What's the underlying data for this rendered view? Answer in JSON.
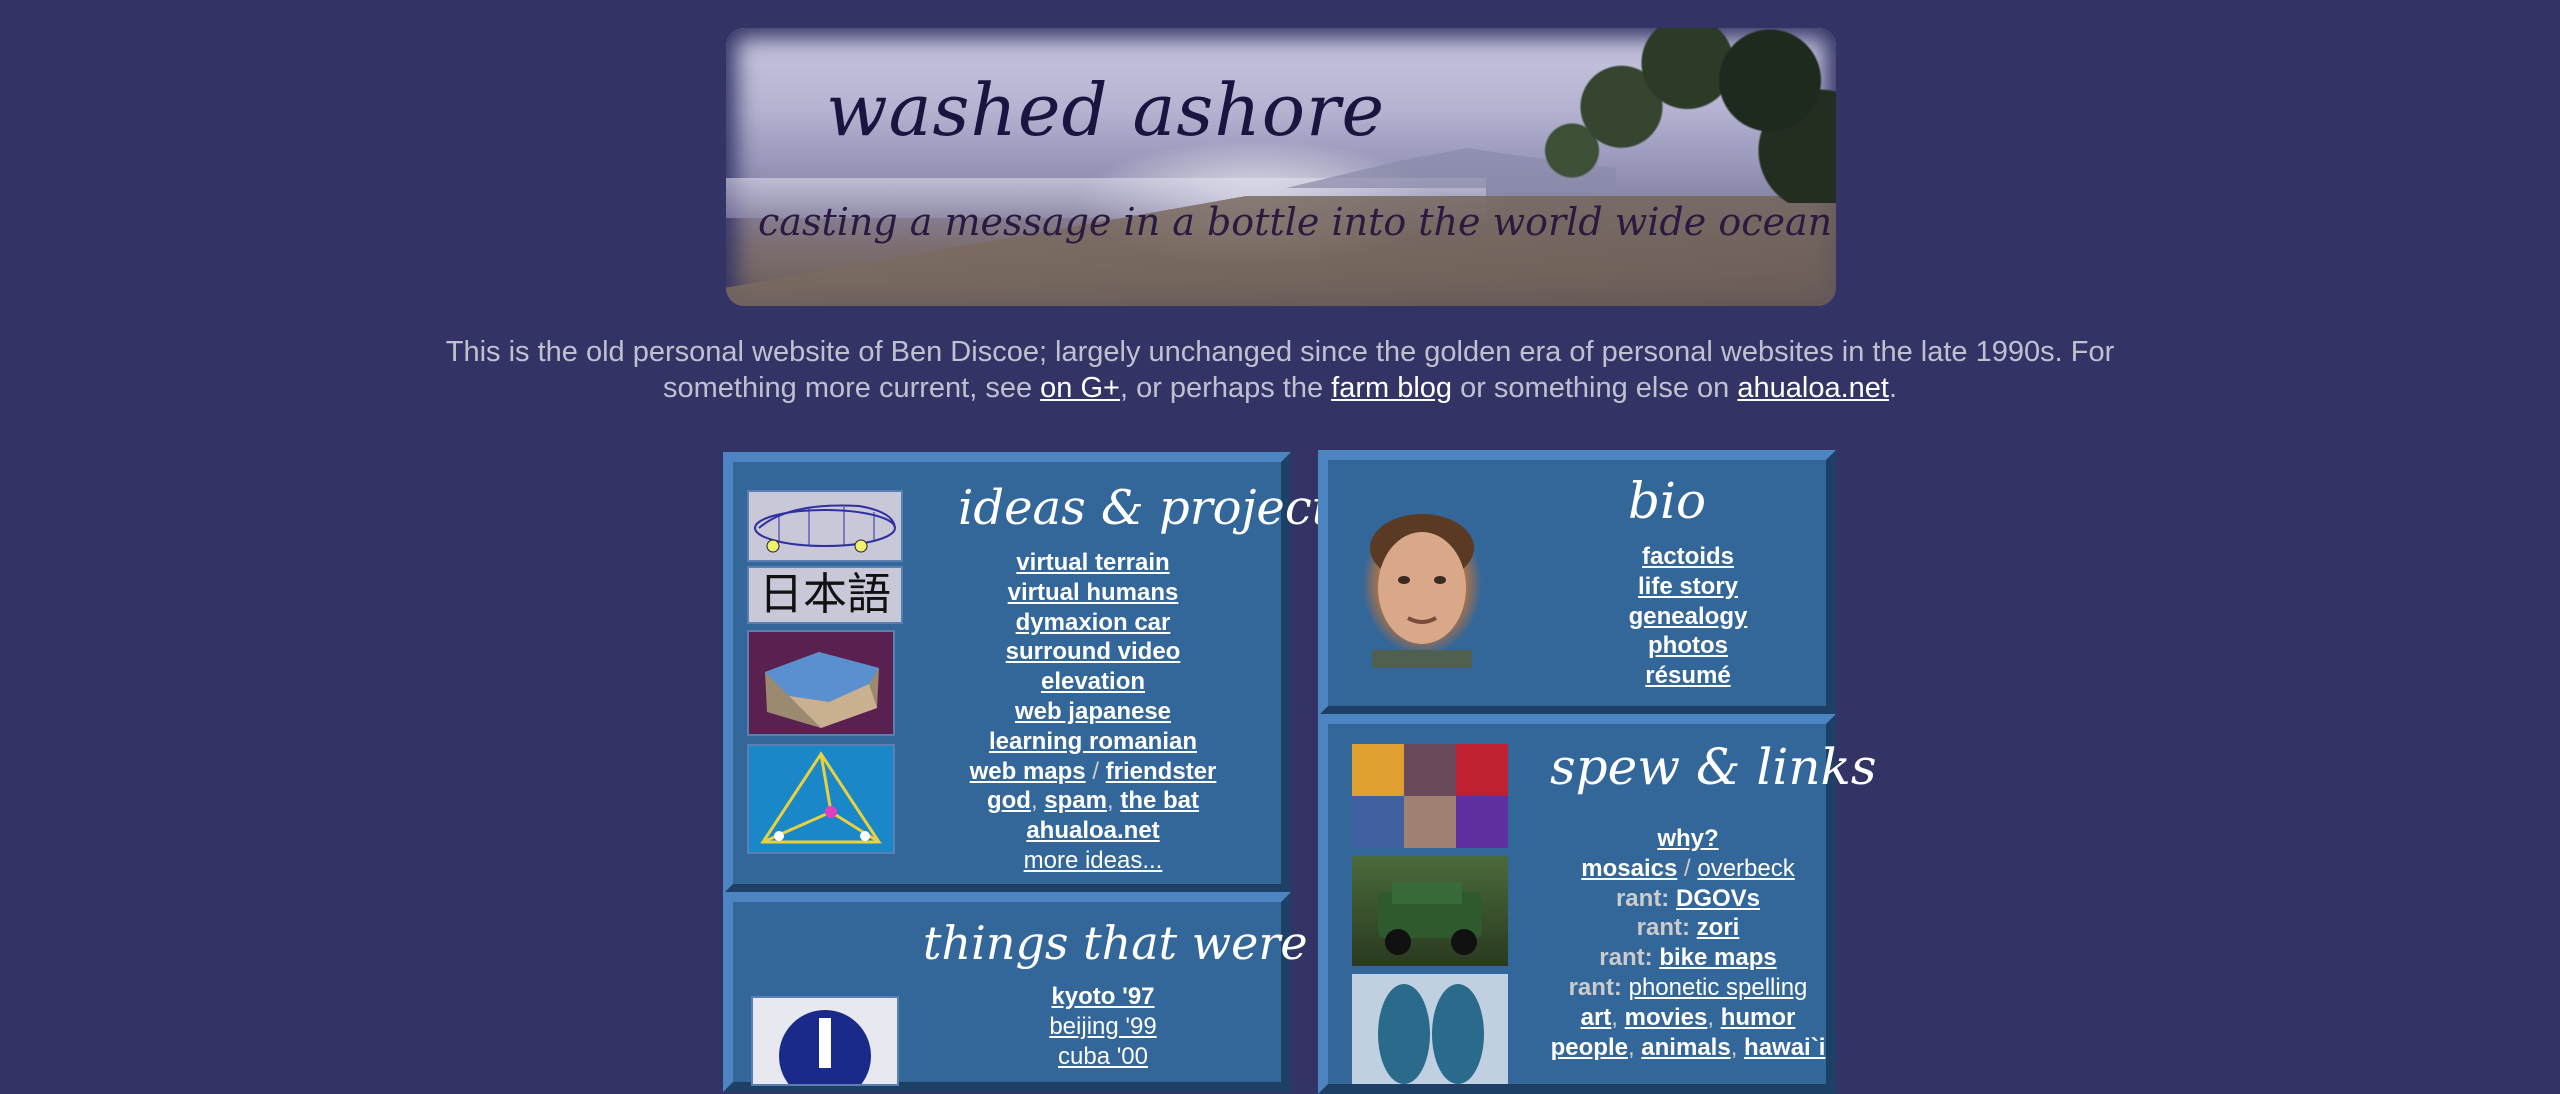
{
  "banner": {
    "title": "washed ashore",
    "subtitle": "casting a message in a bottle into the world wide ocean"
  },
  "intro": {
    "before": "This is the old personal website of Ben Discoe; largely unchanged since the golden era of personal websites in the late 1990s.  For something more current, see ",
    "link1": "on G+",
    "middle1": ", or perhaps the ",
    "link2": "farm blog",
    "middle2": " or something else on ",
    "link3": "ahualoa.net",
    "end": "."
  },
  "ideas": {
    "title": "ideas & projects",
    "thumbs": [
      "car-wireframe-icon",
      "japanese-kanji-icon",
      "terrain-icon",
      "tetrahedron-icon"
    ],
    "kanji": "日本語",
    "items": {
      "virtual_terrain": "virtual terrain",
      "virtual_humans": "virtual humans",
      "dymaxion_car": "dymaxion car",
      "surround_video": "surround video",
      "elevation": "elevation",
      "web_japanese": "web japanese",
      "learning_romanian": "learning romanian",
      "web_maps": "web maps",
      "slash": " / ",
      "friendster": "friendster",
      "god": "god",
      "spam": "spam",
      "the_bat": "the bat",
      "comma": ", ",
      "ahualoa": "ahualoa.net",
      "more": "more ideas..."
    }
  },
  "bio": {
    "title": "bio",
    "items": [
      "factoids",
      "life story",
      "genealogy",
      "photos",
      "résumé"
    ]
  },
  "things": {
    "title": "things that were",
    "items": [
      "kyoto '97",
      "beijing '99",
      "cuba '00"
    ]
  },
  "spew": {
    "title": "spew & links",
    "why": "why?",
    "mosaics": "mosaics",
    "overbeck": "overbeck",
    "rant": "rant:",
    "dgovs": "DGOVs",
    "zori": "zori",
    "bike_maps": "bike maps",
    "phonetic": "phonetic spelling",
    "art": "art",
    "movies": "movies",
    "humor": "humor",
    "people": "people",
    "animals": "animals",
    "hawaii": "hawai`i",
    "slash": " / ",
    "comma": ", "
  },
  "colors": {
    "background": "#333366",
    "box": "#336699",
    "link": "#ffffff",
    "text": "#c0c0d0"
  }
}
